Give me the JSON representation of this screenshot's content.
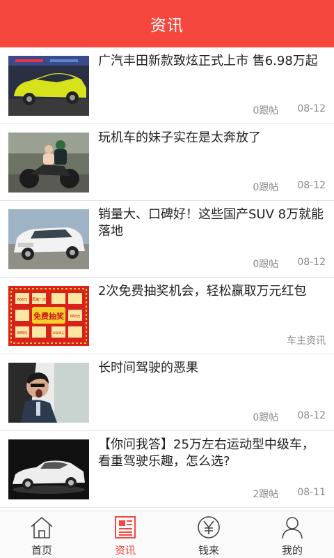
{
  "header": {
    "title": "资讯"
  },
  "articles": [
    {
      "title": "广汽丰田新款致炫正式上市 售6.98万起",
      "comments": "0跟帖",
      "date": "08-12",
      "source": ""
    },
    {
      "title": "玩机车的妹子实在是太奔放了",
      "comments": "0跟帖",
      "date": "08-12",
      "source": ""
    },
    {
      "title": "销量大、口碑好！这些国产SUV 8万就能落地",
      "comments": "0跟帖",
      "date": "08-12",
      "source": ""
    },
    {
      "title": "2次免费抽奖机会，轻松赢取万元红包",
      "comments": "",
      "date": "",
      "source": "车主资讯"
    },
    {
      "title": "长时间驾驶的恶果",
      "comments": "0跟帖",
      "date": "08-12",
      "source": ""
    },
    {
      "title": "【你问我答】25万左右运动型中级车，看重驾驶乐趣，怎么选?",
      "comments": "2跟帖",
      "date": "08-11",
      "source": ""
    }
  ],
  "thumb_text": {
    "lottery_banner": "免费抽奖",
    "prize_small": "666元",
    "prize_mid": "888元",
    "prize_big": "30000元",
    "cell": "再抽一次"
  },
  "tabs": [
    {
      "label": "首页",
      "icon": "home-icon",
      "active": false
    },
    {
      "label": "资讯",
      "icon": "news-icon",
      "active": true
    },
    {
      "label": "钱来",
      "icon": "yuan-icon",
      "active": false
    },
    {
      "label": "我的",
      "icon": "user-icon",
      "active": false
    }
  ],
  "colors": {
    "accent": "#f5473e",
    "text": "#222222",
    "meta": "#888888"
  }
}
